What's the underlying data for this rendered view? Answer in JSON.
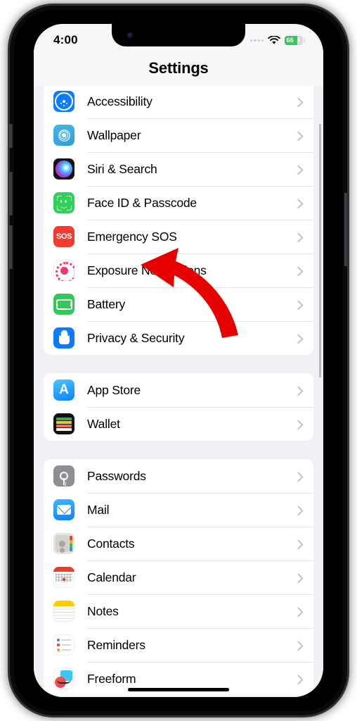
{
  "status_bar": {
    "time": "4:00",
    "cellular_icon": "cellular-dots-icon",
    "wifi_icon": "wifi-icon",
    "battery_percent": "66",
    "battery_charging": true,
    "battery_fill_pct": 66,
    "battery_color": "#34c759"
  },
  "nav": {
    "title": "Settings"
  },
  "annotation": {
    "arrow_color": "#e60000",
    "points_at": "Battery",
    "shape": "curved-arrow-up-left"
  },
  "groups": [
    {
      "id": "group-system",
      "rows": [
        {
          "label": "Accessibility",
          "icon": "accessibility-icon",
          "chevron": true
        },
        {
          "label": "Wallpaper",
          "icon": "wallpaper-icon",
          "chevron": true
        },
        {
          "label": "Siri & Search",
          "icon": "siri-icon",
          "chevron": true
        },
        {
          "label": "Face ID & Passcode",
          "icon": "face-id-icon",
          "chevron": true
        },
        {
          "label": "Emergency SOS",
          "icon": "emergency-sos-icon",
          "chevron": true
        },
        {
          "label": "Exposure Notifications",
          "icon": "exposure-notifications-icon",
          "chevron": true
        },
        {
          "label": "Battery",
          "icon": "battery-icon",
          "chevron": true
        },
        {
          "label": "Privacy & Security",
          "icon": "privacy-security-icon",
          "chevron": true
        }
      ]
    },
    {
      "id": "group-store",
      "rows": [
        {
          "label": "App Store",
          "icon": "app-store-icon",
          "chevron": true
        },
        {
          "label": "Wallet",
          "icon": "wallet-icon",
          "chevron": true
        }
      ]
    },
    {
      "id": "group-apps",
      "rows": [
        {
          "label": "Passwords",
          "icon": "passwords-icon",
          "chevron": true
        },
        {
          "label": "Mail",
          "icon": "mail-icon",
          "chevron": true
        },
        {
          "label": "Contacts",
          "icon": "contacts-icon",
          "chevron": true
        },
        {
          "label": "Calendar",
          "icon": "calendar-icon",
          "chevron": true
        },
        {
          "label": "Notes",
          "icon": "notes-icon",
          "chevron": true
        },
        {
          "label": "Reminders",
          "icon": "reminders-icon",
          "chevron": true
        },
        {
          "label": "Freeform",
          "icon": "freeform-icon",
          "chevron": true
        }
      ]
    }
  ],
  "colors": {
    "page_background": "#f0f0f5",
    "card_background": "#ffffff",
    "separator": "#e3e3e6",
    "chevron": "#c3c3c7",
    "label_text": "#000000"
  }
}
